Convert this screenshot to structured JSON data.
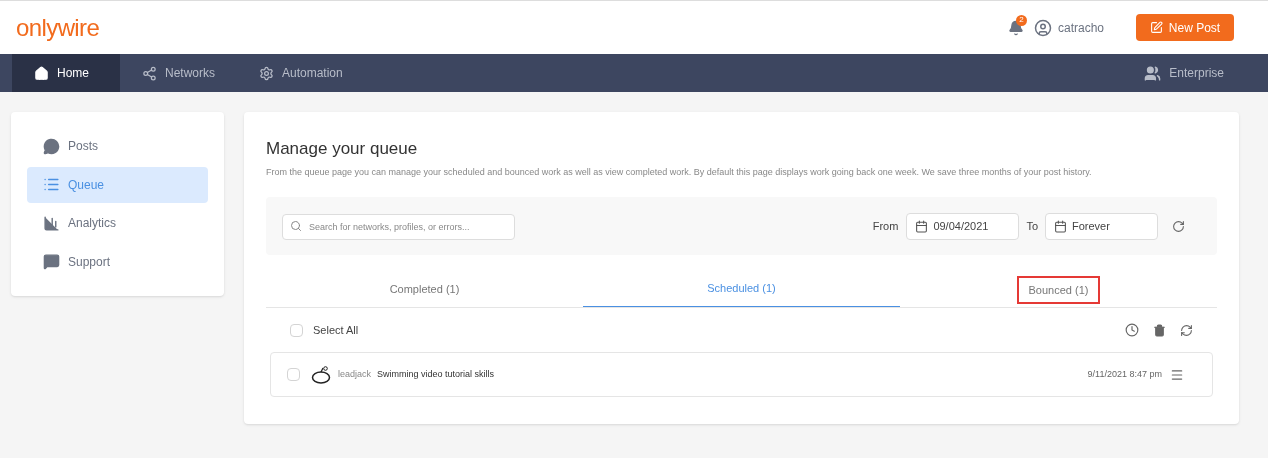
{
  "header": {
    "logo": "onlywire",
    "notifications": "2",
    "user": "catracho",
    "new_post": "New Post"
  },
  "nav": {
    "items": [
      {
        "label": "Home",
        "selected": true
      },
      {
        "label": "Networks",
        "selected": false
      },
      {
        "label": "Automation",
        "selected": false
      }
    ],
    "right": "Enterprise"
  },
  "sidebar": {
    "items": [
      {
        "label": "Posts",
        "selected": false
      },
      {
        "label": "Queue",
        "selected": true
      },
      {
        "label": "Analytics",
        "selected": false
      },
      {
        "label": "Support",
        "selected": false
      }
    ]
  },
  "main": {
    "title": "Manage your queue",
    "description": "From the queue page you can manage your scheduled and bounced work as well as view completed work. By default this page displays work going back one week. We save three months of your post history.",
    "search": {
      "placeholder": "Search for networks, profiles, or errors..."
    },
    "from_label": "From",
    "from_value": "09/04/2021",
    "to_label": "To",
    "to_value": "Forever",
    "tabs": [
      {
        "label": "Completed (1)",
        "selected": false,
        "highlighted": false
      },
      {
        "label": "Scheduled (1)",
        "selected": true,
        "highlighted": false
      },
      {
        "label": "Bounced (1)",
        "selected": false,
        "highlighted": true
      }
    ],
    "select_all": {
      "label": "Select All",
      "checked": false
    },
    "rows": [
      {
        "checked": false,
        "profile": "leadjack",
        "text": "Swimming video tutorial skills",
        "time": "9/11/2021 8:47 pm"
      }
    ]
  }
}
